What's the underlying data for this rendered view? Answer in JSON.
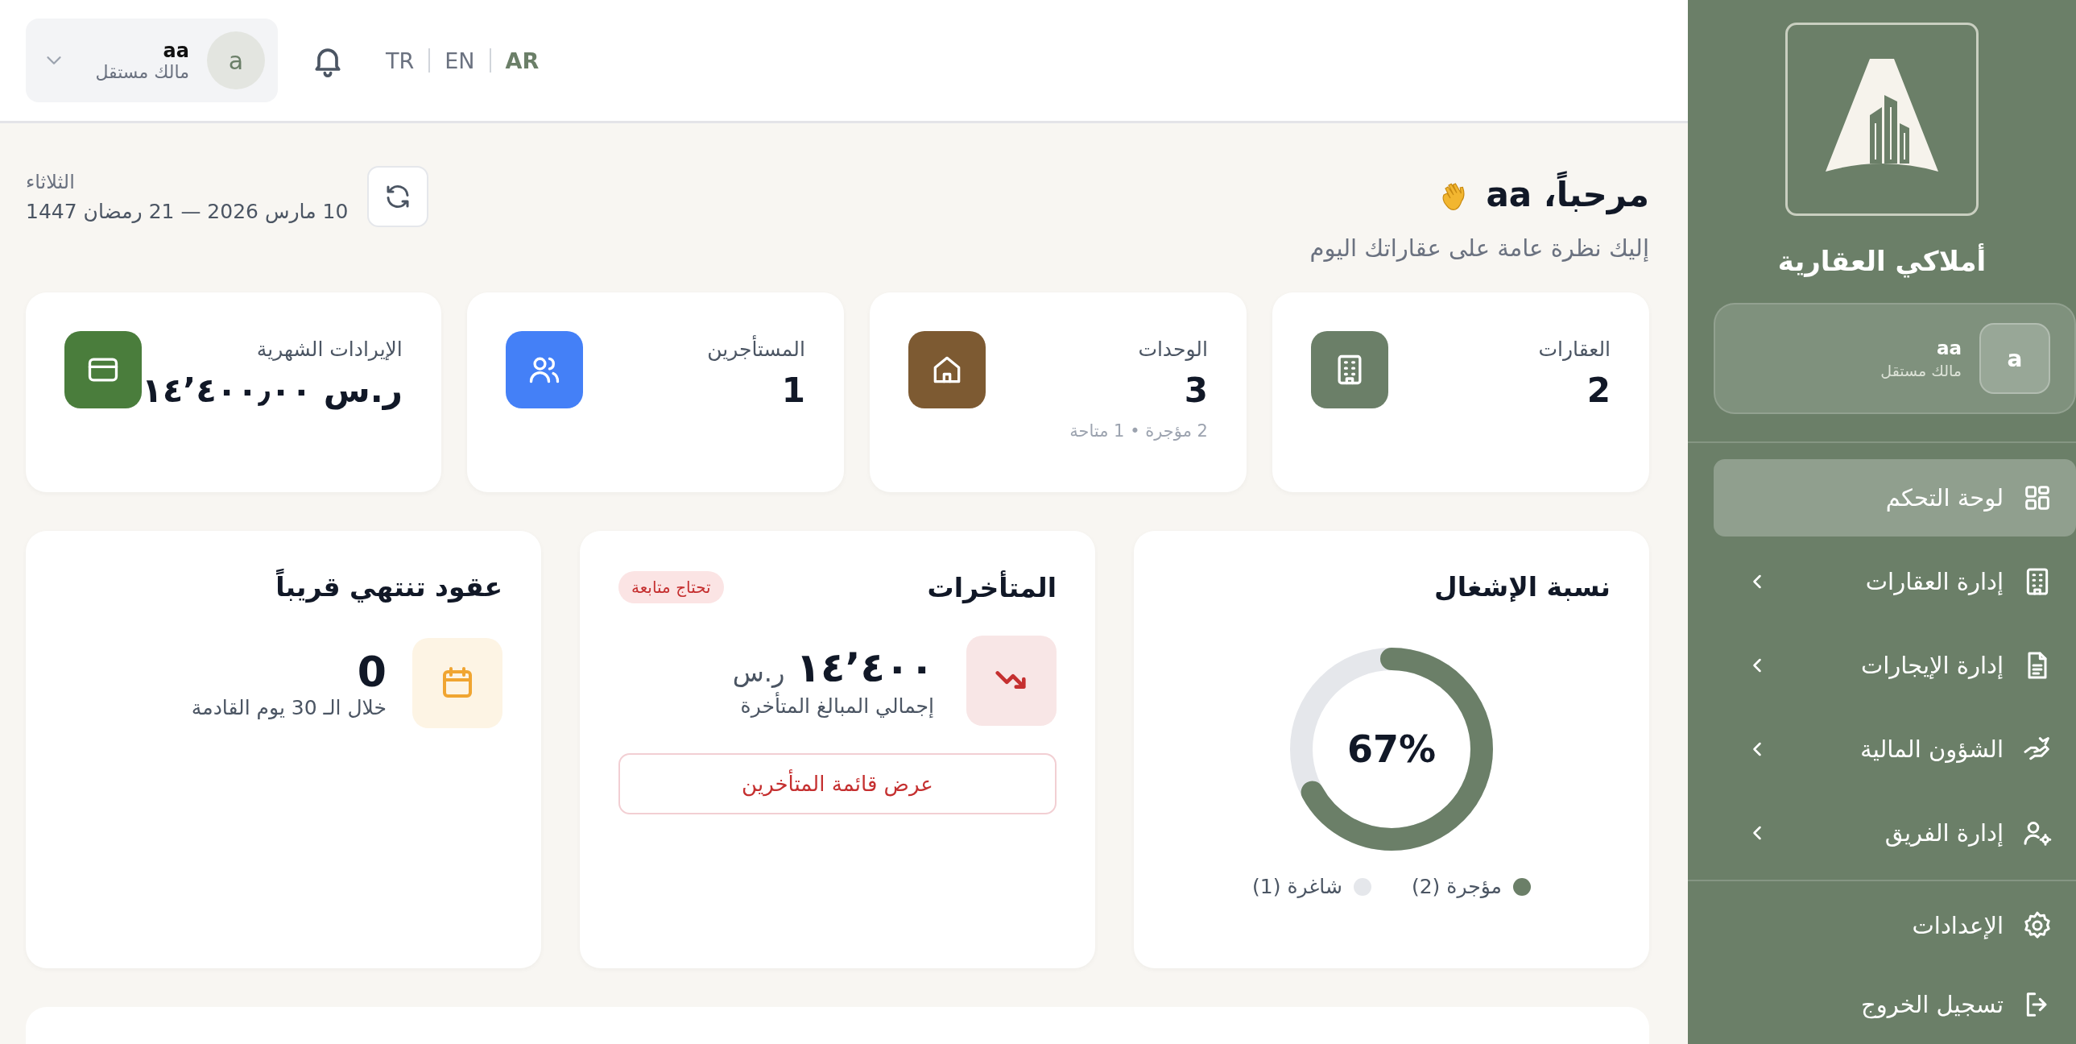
{
  "topbar": {
    "user": {
      "avatar": "a",
      "name": "aa",
      "role": "مالك مستقل"
    },
    "languages": [
      {
        "label": "AR",
        "selected": true
      },
      {
        "label": "EN",
        "selected": false
      },
      {
        "label": "TR",
        "selected": false
      }
    ]
  },
  "welcome": {
    "title": "مرحباً، aa",
    "subtitle": "إليك نظرة عامة على عقاراتك اليوم"
  },
  "date": {
    "weekday": "الثلاثاء",
    "date": "10 مارس 2026 — 21 رمضان 1447"
  },
  "stats": [
    {
      "kind": "building",
      "label": "العقارات",
      "value": "2",
      "color": "#6b7f68"
    },
    {
      "kind": "home",
      "label": "الوحدات",
      "value": "3",
      "note": "2 مؤجرة • 1 متاحة",
      "color": "#7d5a32"
    },
    {
      "kind": "users",
      "label": "المستأجرين",
      "value": "1",
      "color": "#4480f7"
    },
    {
      "kind": "card",
      "label": "الإيرادات الشهرية",
      "value": "ر.س ١٤٬٤٠٠٫٠٠",
      "color": "#4a7d3c"
    }
  ],
  "occupancy": {
    "title": "نسبة الإشغال",
    "level": 0.67,
    "reading": "67%",
    "legend": [
      {
        "label": "مؤجرة (2)",
        "color": "#6b7f68"
      },
      {
        "label": "شاغرة (1)",
        "color": "#e5e7eb"
      }
    ]
  },
  "overdue": {
    "title": "المتأخرات",
    "badge": "تحتاج متابعة",
    "amount": "١٤٬٤٠٠",
    "currency": "ر.س",
    "caption": "إجمالي المبالغ المتأخرة",
    "button": "عرض قائمة المتأخرين"
  },
  "expiring": {
    "title": "عقود تنتهي قريباً",
    "count": "0",
    "caption": "خلال الـ 30 يوم القادمة"
  },
  "sidebar": {
    "brand": "أملاكي العقارية",
    "user": {
      "avatar": "a",
      "name": "aa",
      "role": "مالك مستقل"
    },
    "nav": [
      {
        "kind": "grid",
        "label": "لوحة التحكم",
        "selected": true,
        "has_submenu": false
      },
      {
        "kind": "building",
        "label": "إدارة العقارات",
        "selected": false,
        "has_submenu": true
      },
      {
        "kind": "document",
        "label": "إدارة الإيجارات",
        "selected": false,
        "has_submenu": true
      },
      {
        "kind": "money",
        "label": "الشؤون المالية",
        "selected": false,
        "has_submenu": true
      },
      {
        "kind": "team",
        "label": "إدارة الفريق",
        "selected": false,
        "has_submenu": true
      }
    ],
    "footer": [
      {
        "kind": "gear",
        "label": "الإعدادات"
      },
      {
        "kind": "logout",
        "label": "تسجيل الخروج"
      }
    ]
  }
}
